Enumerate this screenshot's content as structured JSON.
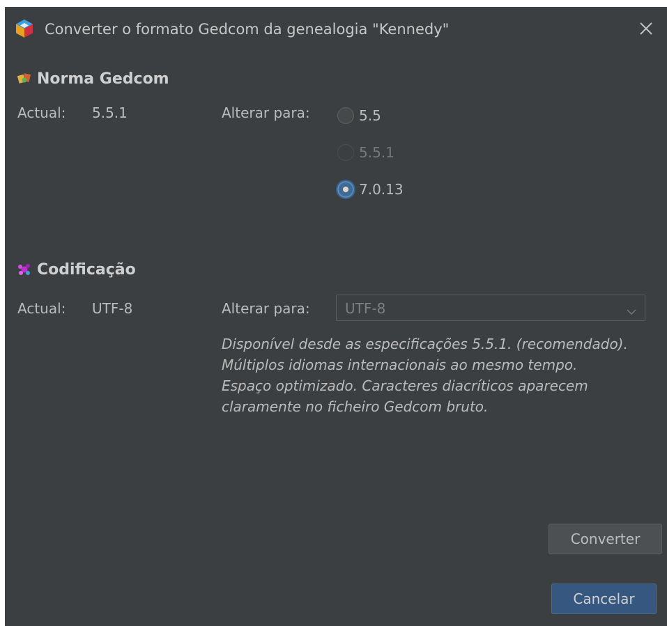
{
  "window": {
    "title": "Converter o formato Gedcom da genealogia \"Kennedy\"",
    "app_icon": "ancestris-cube-icon",
    "close_icon": "close-icon"
  },
  "norma": {
    "section_title": "Norma Gedcom",
    "icon": "gedcom-norm-icon",
    "current_label": "Actual:",
    "current_value": "5.5.1",
    "change_label": "Alterar para:",
    "options": [
      {
        "label": "5.5",
        "state": "unselected"
      },
      {
        "label": "5.5.1",
        "state": "disabled"
      },
      {
        "label": "7.0.13",
        "state": "selected"
      }
    ]
  },
  "codificacao": {
    "section_title": "Codificação",
    "icon": "encoding-icon",
    "current_label": "Actual:",
    "current_value": "UTF-8",
    "change_label": "Alterar para:",
    "select_value": "UTF-8",
    "description_lines": [
      "Disponível desde as especificações 5.5.1. (recomendado).",
      "Múltiplos idiomas internacionais ao mesmo tempo.",
      "Espaço optimizado. Caracteres diacríticos aparecem",
      "claramente no ficheiro Gedcom bruto."
    ]
  },
  "buttons": {
    "convert": "Converter",
    "cancel": "Cancelar"
  },
  "colors": {
    "background": "#3c3f41",
    "text": "#bbbbbb",
    "accent": "#365880"
  }
}
